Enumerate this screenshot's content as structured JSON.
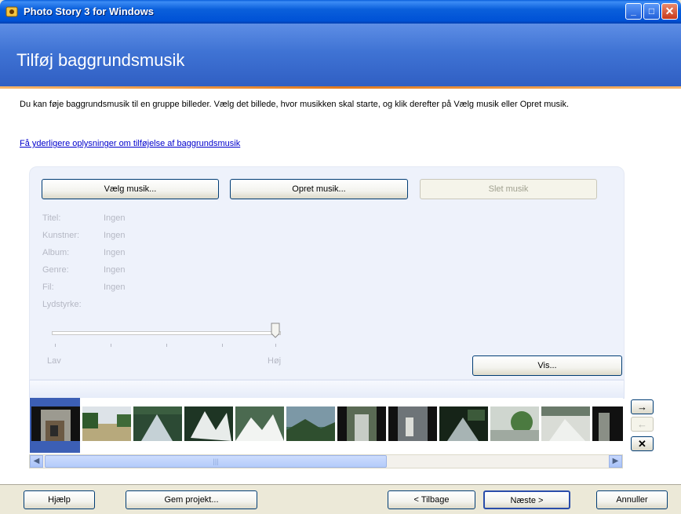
{
  "window": {
    "title": "Photo Story 3 for Windows"
  },
  "header": {
    "title": "Tilføj baggrundsmusik"
  },
  "instructions": "Du kan føje baggrundsmusik til en gruppe billeder. Vælg det billede, hvor musikken skal starte, og klik derefter på Vælg musik eller Opret musik.",
  "help_link": "Få yderligere oplysninger om tilføjelse af baggrundsmusik",
  "buttons": {
    "choose_music": "Vælg musik...",
    "create_music": "Opret musik...",
    "delete_music": "Slet musik",
    "preview": "Vis..."
  },
  "metadata": [
    {
      "label": "Titel:",
      "value": "Ingen"
    },
    {
      "label": "Kunstner:",
      "value": "Ingen"
    },
    {
      "label": "Album:",
      "value": "Ingen"
    },
    {
      "label": "Genre:",
      "value": "Ingen"
    },
    {
      "label": "Fil:",
      "value": "Ingen"
    }
  ],
  "volume": {
    "label": "Lydstyrke:",
    "low": "Lav",
    "high": "Høj",
    "level": 1.0
  },
  "filmstrip": {
    "count": 12,
    "selected_index": 0
  },
  "side_buttons": {
    "move_right": "→",
    "move_left": "←",
    "remove": "✕"
  },
  "footer": {
    "help": "Hjælp",
    "save": "Gem projekt...",
    "back": "< Tilbage",
    "next": "Næste >",
    "cancel": "Annuller"
  }
}
